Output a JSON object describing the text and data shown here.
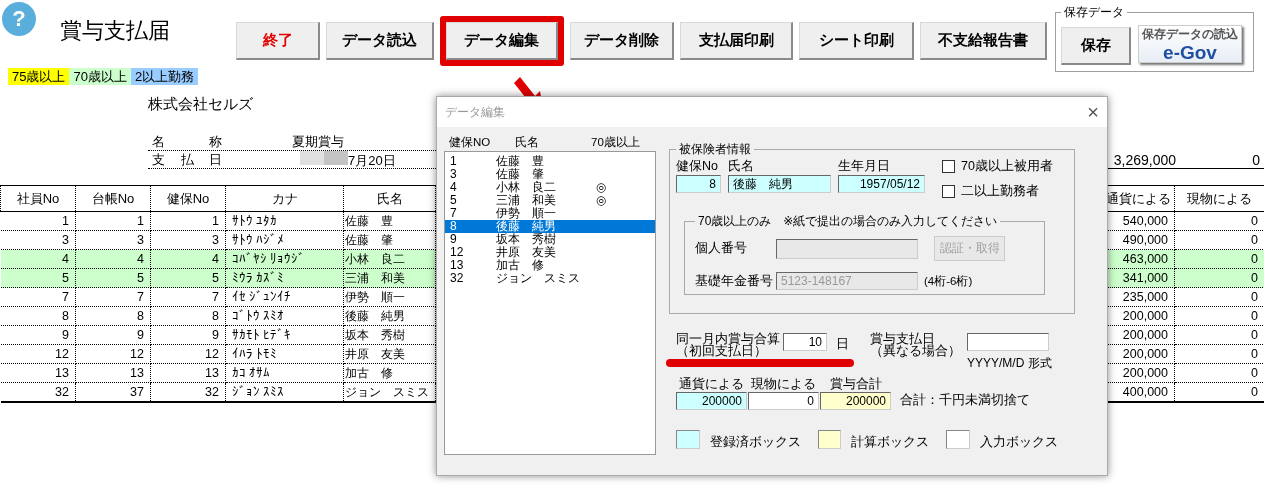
{
  "app": {
    "help_icon": "?",
    "title": "賞与支払届"
  },
  "toolbar": [
    {
      "label": "終了",
      "kind": "exit",
      "highlighted": false
    },
    {
      "label": "データ読込",
      "kind": "plain",
      "highlighted": false
    },
    {
      "label": "データ編集",
      "kind": "plain",
      "highlighted": true
    },
    {
      "label": "データ削除",
      "kind": "plain",
      "highlighted": false
    },
    {
      "label": "支払届印刷",
      "kind": "plain",
      "highlighted": false
    },
    {
      "label": "シート印刷",
      "kind": "plain",
      "highlighted": false
    },
    {
      "label": "不支給報告書",
      "kind": "plain",
      "highlighted": false
    }
  ],
  "save_group": {
    "title": "保存データ",
    "buttons": [
      {
        "kind": "plain",
        "label": "保存"
      },
      {
        "kind": "egov",
        "caption": "保存データの読込",
        "label": "e-Gov"
      }
    ]
  },
  "legend": [
    {
      "label": "75歳以上",
      "color": "#ffff00"
    },
    {
      "label": "70歳以上",
      "color": "#ccffcc"
    },
    {
      "label": "2以上勤務",
      "color": "#99ccff"
    }
  ],
  "company": "株式会社セルズ",
  "info": [
    {
      "label": "名称",
      "value": "夏期賞与",
      "redacted": false
    },
    {
      "label": "支払日",
      "value": "7月20日",
      "redacted": true
    }
  ],
  "totals": [
    "3,269,000",
    "0"
  ],
  "table": {
    "columns": [
      "社員No",
      "台帳No",
      "健保No",
      "カナ",
      "氏名",
      "通貨による",
      "現物による"
    ],
    "rows": [
      {
        "cells": [
          "1",
          "1",
          "1",
          "ｻﾄｳ ﾕﾀｶ",
          "佐藤　豊",
          "540,000",
          "0"
        ],
        "color": "#ffffff"
      },
      {
        "cells": [
          "3",
          "3",
          "3",
          "ｻﾄｳ ﾊｼﾞﾒ",
          "佐藤　肇",
          "490,000",
          "0"
        ],
        "color": "#ffffff"
      },
      {
        "cells": [
          "4",
          "4",
          "4",
          "ｺﾊﾞﾔｼ ﾘｮｳｼﾞ",
          "小林　良二",
          "463,000",
          "0"
        ],
        "color": "#ccffcc"
      },
      {
        "cells": [
          "5",
          "5",
          "5",
          "ﾐｳﾗ ｶｽﾞﾐ",
          "三浦　和美",
          "341,000",
          "0"
        ],
        "color": "#ccffcc"
      },
      {
        "cells": [
          "7",
          "7",
          "7",
          "ｲｾ ｼﾞｭﾝｲﾁ",
          "伊勢　順一",
          "235,000",
          "0"
        ],
        "color": "#ffffff"
      },
      {
        "cells": [
          "8",
          "8",
          "8",
          "ｺﾞﾄｳ ｽﾐｵ",
          "後藤　純男",
          "200,000",
          "0"
        ],
        "color": "#ffffff"
      },
      {
        "cells": [
          "9",
          "9",
          "9",
          "ｻｶﾓﾄ ﾋﾃﾞｷ",
          "坂本　秀樹",
          "200,000",
          "0"
        ],
        "color": "#ffffff"
      },
      {
        "cells": [
          "12",
          "12",
          "12",
          "ｲﾊﾗ ﾄﾓﾐ",
          "井原　友美",
          "200,000",
          "0"
        ],
        "color": "#ffffff"
      },
      {
        "cells": [
          "13",
          "13",
          "13",
          "ｶｺ ｵｻﾑ",
          "加古　修",
          "200,000",
          "0"
        ],
        "color": "#ffffff"
      },
      {
        "cells": [
          "32",
          "37",
          "32",
          "ｼﾞｮﾝ ｽﾐｽ",
          "ジョン　スミス",
          "400,000",
          "0"
        ],
        "color": "#ffffff"
      }
    ]
  },
  "dialog": {
    "title": "データ編集",
    "close": "×",
    "list": {
      "columns": [
        "健保NO",
        "氏名",
        "70歳以上"
      ],
      "items": [
        {
          "no": "1",
          "name": "佐藤　豊",
          "selected": false
        },
        {
          "no": "3",
          "name": "佐藤　肇",
          "selected": false
        },
        {
          "no": "4",
          "name": "小林　良二",
          "mark": "◎",
          "selected": false
        },
        {
          "no": "5",
          "name": "三浦　和美",
          "mark": "◎",
          "selected": false
        },
        {
          "no": "7",
          "name": "伊勢　順一",
          "selected": false
        },
        {
          "no": "8",
          "name": "後藤　純男",
          "selected": true
        },
        {
          "no": "9",
          "name": "坂本　秀樹",
          "selected": false
        },
        {
          "no": "12",
          "name": "井原　友美",
          "selected": false
        },
        {
          "no": "13",
          "name": "加古　修",
          "selected": false
        },
        {
          "no": "32",
          "name": "ジョン　スミス",
          "selected": false
        }
      ]
    },
    "insured": {
      "title": "被保険者情報",
      "fields": [
        {
          "label": "健保No",
          "value": "8",
          "kind": "registered"
        },
        {
          "label": "氏名",
          "value": "後藤　純男",
          "kind": "registered"
        },
        {
          "label": "生年月日",
          "value": "1957/05/12",
          "kind": "registered"
        }
      ],
      "checks": [
        {
          "label": "70歳以上被用者",
          "checked": false
        },
        {
          "label": "二以上勤務者",
          "checked": false
        }
      ],
      "senior": {
        "title": "70歳以上のみ　※紙で提出の場合のみ入力してください",
        "my_number": {
          "label": "個人番号",
          "disabled": true
        },
        "auth_button": {
          "label": "認証・取得",
          "disabled": true
        },
        "pension": {
          "label": "基礎年金番号",
          "value": "5123-148167",
          "disabled": true,
          "hint": "(4桁-6桁)"
        }
      }
    },
    "combine": {
      "label": [
        "同一月内賞与合算",
        "（初回支払日）"
      ],
      "value": "10",
      "unit": "日",
      "underlined": true
    },
    "pay_date": {
      "label": [
        "賞与支払日",
        "（異なる場合）"
      ],
      "format": "YYYY/M/D 形式"
    },
    "amounts": [
      {
        "label": "通貨による",
        "value": "200000",
        "kind": "registered"
      },
      {
        "label": "現物による",
        "value": "0",
        "kind": "input"
      },
      {
        "label": "賞与合計",
        "value": "200000",
        "kind": "calculated"
      }
    ],
    "amount_note": "合計：千円未満切捨て",
    "box_legend": [
      {
        "kind": "registered",
        "label": "登録済ボックス"
      },
      {
        "kind": "calculated",
        "label": "計算ボックス"
      },
      {
        "kind": "input",
        "label": "入力ボックス"
      }
    ]
  }
}
